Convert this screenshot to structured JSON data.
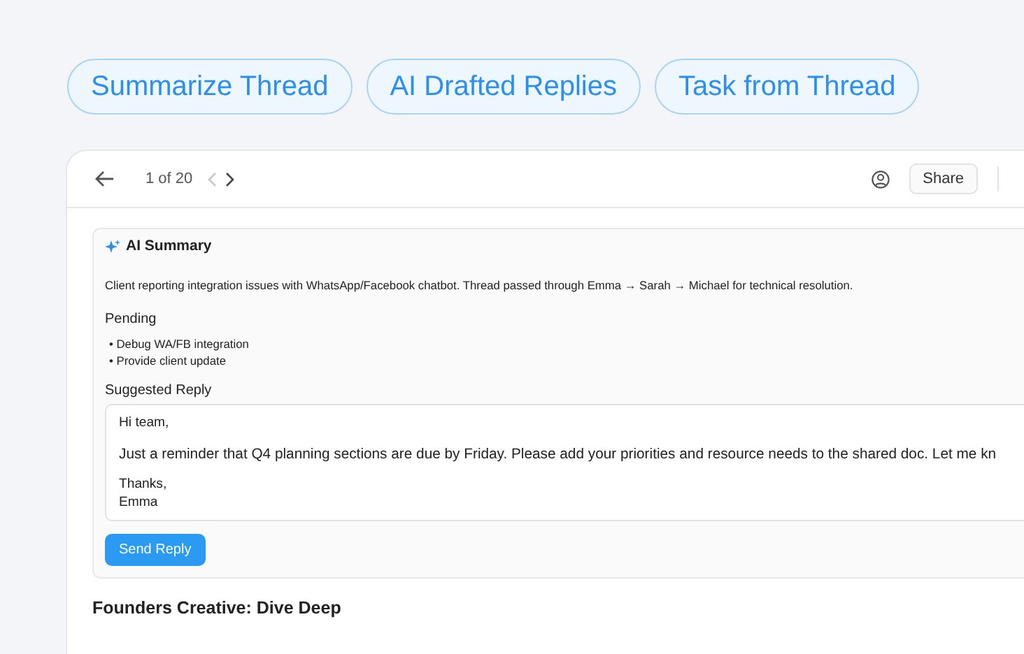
{
  "feature_chips": [
    "Summarize Thread",
    "AI Drafted Replies",
    "Task from Thread"
  ],
  "toolbar": {
    "counter": "1 of 20",
    "prev_disabled": true,
    "share": "Share"
  },
  "summary": {
    "title": "AI Summary",
    "text": "Client reporting integration issues with WhatsApp/Facebook chatbot. Thread passed through Emma → Sarah → Michael for technical resolution.",
    "pending_title": "Pending",
    "pending": [
      "• Debug WA/FB integration",
      "• Provide client update"
    ],
    "reply_label": "Suggested Reply",
    "reply": {
      "greeting": "Hi team,",
      "body": "Just a reminder that Q4 planning sections are due by Friday. Please add your priorities and resource needs to the shared doc. Let me kn",
      "closing": [
        "Thanks,",
        "Emma"
      ]
    },
    "send": "Send Reply"
  },
  "thread_title": "Founders Creative: Dive Deep"
}
